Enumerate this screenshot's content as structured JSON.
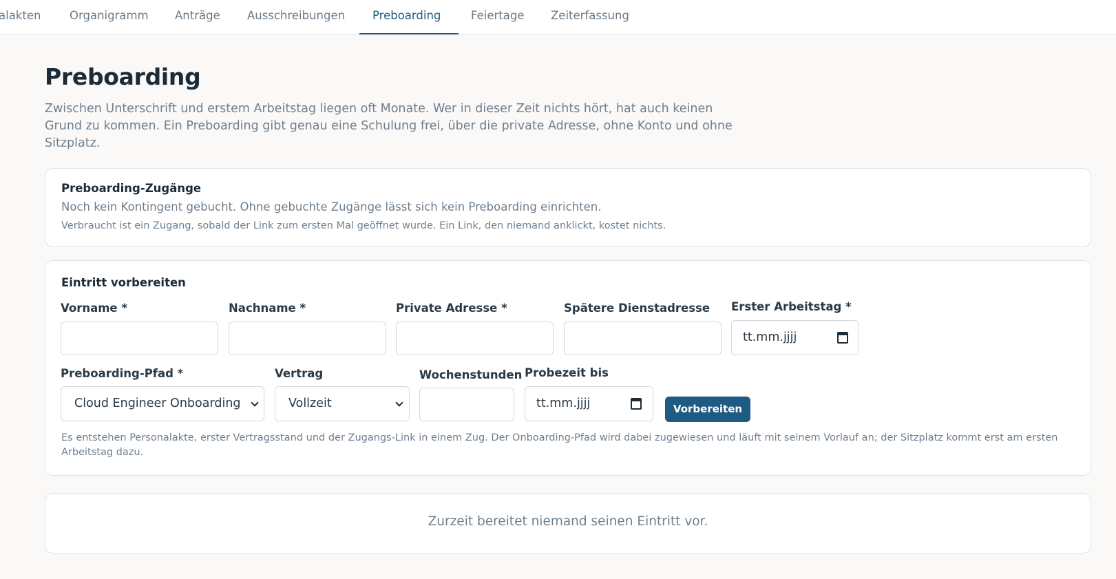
{
  "tabs": [
    {
      "label": "alakten",
      "active": false
    },
    {
      "label": "Organigramm",
      "active": false
    },
    {
      "label": "Anträge",
      "active": false
    },
    {
      "label": "Ausschreibungen",
      "active": false
    },
    {
      "label": "Preboarding",
      "active": true
    },
    {
      "label": "Feiertage",
      "active": false
    },
    {
      "label": "Zeiterfassung",
      "active": false
    }
  ],
  "page": {
    "title": "Preboarding",
    "intro": "Zwischen Unterschrift und erstem Arbeitstag liegen oft Monate. Wer in dieser Zeit nichts hört, hat auch keinen Grund zu kommen. Ein Preboarding gibt genau eine Schulung frei, über die private Adresse, ohne Konto und ohne Sitzplatz."
  },
  "access_card": {
    "title": "Preboarding-Zugänge",
    "status": "Noch kein Kontingent gebucht. Ohne gebuchte Zugänge lässt sich kein Preboarding einrichten.",
    "hint": "Verbraucht ist ein Zugang, sobald der Link zum ersten Mal geöffnet wurde. Ein Link, den niemand anklickt, kostet nichts."
  },
  "form": {
    "title": "Eintritt vorbereiten",
    "fields": {
      "vorname": {
        "label": "Vorname *",
        "value": ""
      },
      "nachname": {
        "label": "Nachname *",
        "value": ""
      },
      "private_adresse": {
        "label": "Private Adresse *",
        "value": ""
      },
      "dienstadresse": {
        "label": "Spätere Dienstadresse",
        "value": ""
      },
      "erster_arbeitstag": {
        "label": "Erster Arbeitstag *",
        "placeholder": "tt.mm.jjjj"
      },
      "pfad": {
        "label": "Preboarding-Pfad *",
        "selected": "Cloud Engineer Onboarding"
      },
      "vertrag": {
        "label": "Vertrag",
        "selected": "Vollzeit"
      },
      "wochenstunden": {
        "label": "Wochenstunden",
        "value": ""
      },
      "probezeit": {
        "label": "Probezeit bis",
        "placeholder": "tt.mm.jjjj"
      }
    },
    "submit_label": "Vorbereiten",
    "note": "Es entstehen Personalakte, erster Vertragsstand und der Zugangs-Link in einem Zug. Der Onboarding-Pfad wird dabei zugewiesen und läuft mit seinem Vorlauf an; der Sitzplatz kommt erst am ersten Arbeitstag dazu."
  },
  "empty_state": "Zurzeit bereitet niemand seinen Eintritt vor.",
  "colors": {
    "accent": "#1f5a82",
    "background": "#faf9f8"
  }
}
